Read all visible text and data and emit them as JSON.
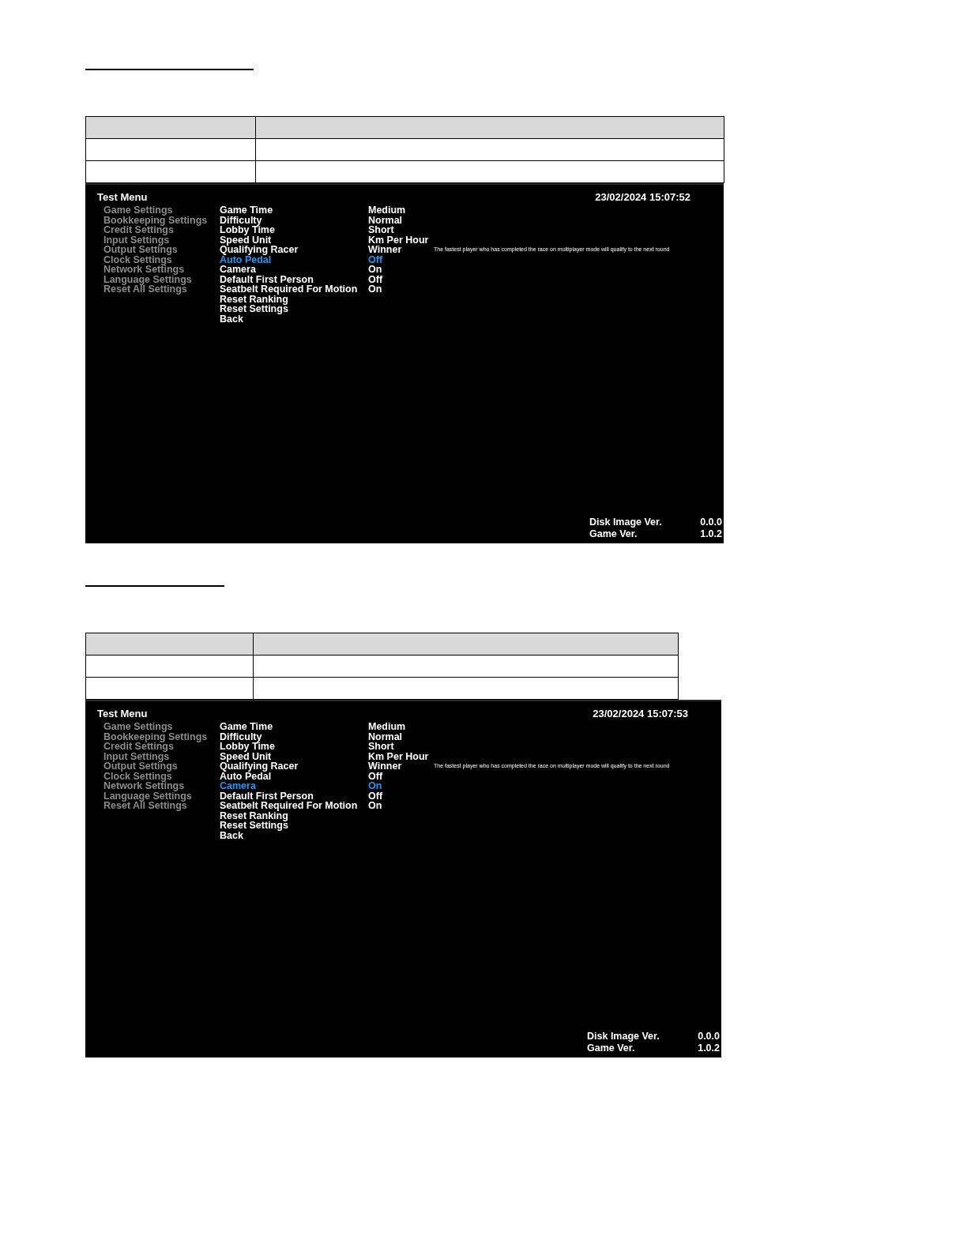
{
  "sections": [
    {
      "screen": {
        "title": "Test Menu",
        "datetime": "23/02/2024 15:07:52",
        "categories": [
          "Game Settings",
          "Bookkeeping Settings",
          "Credit Settings",
          "Input Settings",
          "Output Settings",
          "Clock Settings",
          "Network Settings",
          "Language Settings",
          "Reset All Settings"
        ],
        "settings": [
          {
            "label": "Game Time",
            "value": "Medium",
            "selected": false
          },
          {
            "label": "Difficulty",
            "value": "Normal",
            "selected": false
          },
          {
            "label": "Lobby Time",
            "value": "Short",
            "selected": false
          },
          {
            "label": "Speed Unit",
            "value": "Km Per Hour",
            "selected": false
          },
          {
            "label": "Qualifying Racer",
            "value": "Winner",
            "description": "The fastest player who has completed the race on multiplayer mode will qualify to the next round",
            "selected": false
          },
          {
            "label": "Auto Pedal",
            "value": "Off",
            "selected": true
          },
          {
            "label": "Camera",
            "value": "On",
            "selected": false
          },
          {
            "label": "Default First Person",
            "value": "Off",
            "selected": false
          },
          {
            "label": "Seatbelt Required For Motion",
            "value": "On",
            "selected": false
          },
          {
            "label": "Reset Ranking",
            "selected": false
          },
          {
            "label": "Reset Settings",
            "selected": false
          },
          {
            "label": "Back",
            "selected": false
          }
        ],
        "versions": [
          {
            "label": "Disk Image Ver.",
            "value": "0.0.0"
          },
          {
            "label": "Game Ver.",
            "value": "1.0.2"
          }
        ]
      }
    },
    {
      "screen": {
        "title": "Test Menu",
        "datetime": "23/02/2024 15:07:53",
        "categories": [
          "Game Settings",
          "Bookkeeping Settings",
          "Credit Settings",
          "Input Settings",
          "Output Settings",
          "Clock Settings",
          "Network Settings",
          "Language Settings",
          "Reset All Settings"
        ],
        "settings": [
          {
            "label": "Game Time",
            "value": "Medium",
            "selected": false
          },
          {
            "label": "Difficulty",
            "value": "Normal",
            "selected": false
          },
          {
            "label": "Lobby Time",
            "value": "Short",
            "selected": false
          },
          {
            "label": "Speed Unit",
            "value": "Km Per Hour",
            "selected": false
          },
          {
            "label": "Qualifying Racer",
            "value": "Winner",
            "description": "The fastest player who has completed the race on multiplayer mode will qualify to the next round",
            "selected": false
          },
          {
            "label": "Auto Pedal",
            "value": "Off",
            "selected": false
          },
          {
            "label": "Camera",
            "value": "On",
            "selected": true
          },
          {
            "label": "Default First Person",
            "value": "Off",
            "selected": false
          },
          {
            "label": "Seatbelt Required For Motion",
            "value": "On",
            "selected": false
          },
          {
            "label": "Reset Ranking",
            "selected": false
          },
          {
            "label": "Reset Settings",
            "selected": false
          },
          {
            "label": "Back",
            "selected": false
          }
        ],
        "versions": [
          {
            "label": "Disk Image Ver.",
            "value": "0.0.0"
          },
          {
            "label": "Game Ver.",
            "value": "1.0.2"
          }
        ]
      }
    }
  ]
}
